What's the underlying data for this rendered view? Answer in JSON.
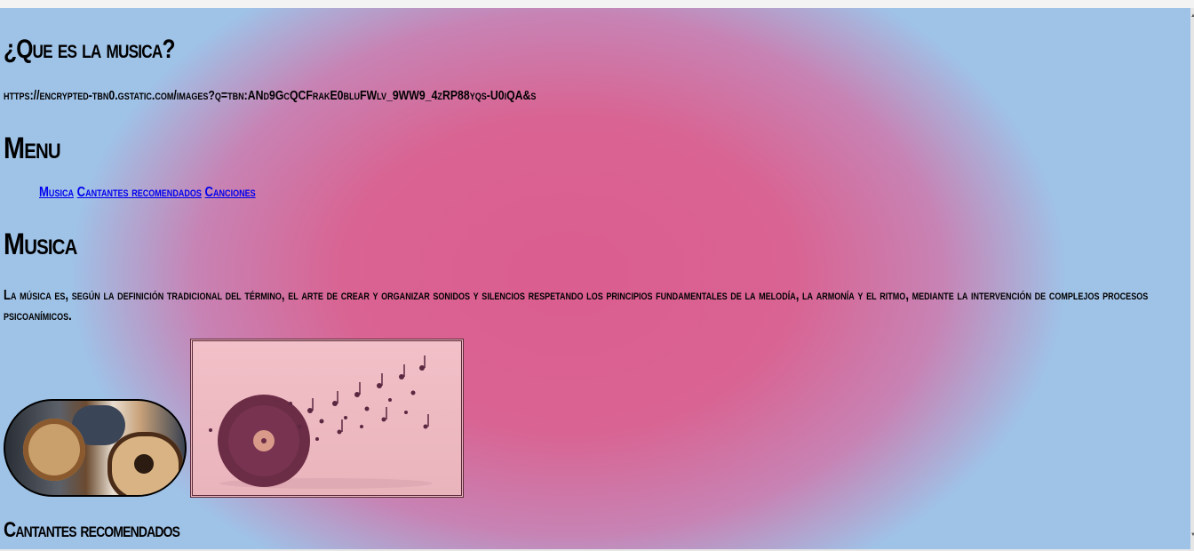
{
  "page": {
    "title": "¿Que es la musica?",
    "image_url_text": "https://encrypted-tbn0.gstatic.com/images?q=tbn:ANd9GcQCFrakE0bluFWlv_9WW9_4zRP88yqs-U0iQA&s"
  },
  "menu": {
    "heading": "Menu",
    "links": [
      "Musica",
      "Cantantes recomendados",
      "Canciones"
    ]
  },
  "musica": {
    "heading": "Musica",
    "text": "La música es, según la definición tradicional del término, el arte de crear y organizar sonidos y silencios respetando los principios fundamentales de la melodía, la armonía y el ritmo, mediante la intervención de complejos procesos psicoanímicos."
  },
  "cantantes": {
    "heading": "Cantantes recomendados"
  },
  "colors": {
    "background_center": "#da5e90",
    "background_edge": "#9fc2e7",
    "link": "#0000ee"
  }
}
